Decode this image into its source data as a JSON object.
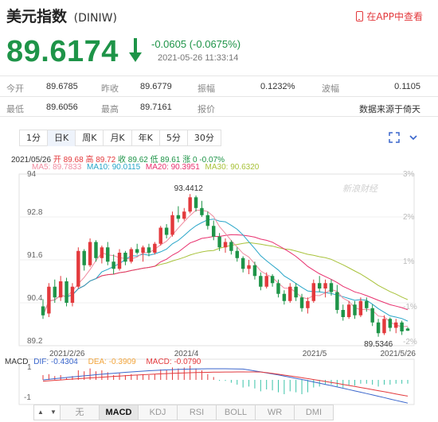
{
  "header": {
    "title": "美元指数",
    "code": "(DINIW)",
    "app_link": "在APP中查看"
  },
  "quote": {
    "price": "89.6174",
    "change": "-0.0605",
    "change_pct": "(-0.0675%)",
    "timestamp": "2021-05-26 11:33:14",
    "color": "#1e9448"
  },
  "info": {
    "row1": [
      {
        "label": "今开",
        "value": "89.6785"
      },
      {
        "label": "昨收",
        "value": "89.6779"
      },
      {
        "label": "振幅",
        "value": "0.1232%"
      },
      {
        "label": "波幅",
        "value": "0.1105"
      }
    ],
    "row2": [
      {
        "label": "最低",
        "value": "89.6056"
      },
      {
        "label": "最高",
        "value": "89.7161"
      },
      {
        "label": "报价",
        "value": "数据来源于倚天"
      }
    ]
  },
  "period_tabs": [
    "1分",
    "日K",
    "周K",
    "月K",
    "年K",
    "5分",
    "30分"
  ],
  "active_period": "日K",
  "tools": [
    "expand-icon",
    "chevron-down-icon"
  ],
  "ohlc_legend": {
    "date": "2021/05/26",
    "open": "开 89.68",
    "high": "高 89.72",
    "close": "收 89.62",
    "low": "低 89.61",
    "change": "涨 0 -0.07%"
  },
  "ma_legend": {
    "ma5": "MA5: 89.7833",
    "ma10": "MA10: 90.0115",
    "ma20": "MA20: 90.3951",
    "ma30": "MA30: 90.6320"
  },
  "colors": {
    "up": "#e3393c",
    "down": "#1e9448",
    "ma5": "#f08ca0",
    "ma10": "#27a5c8",
    "ma20": "#e8306e",
    "ma30": "#a8c23a",
    "diff": "#3a66cc",
    "dea": "#f2a43a",
    "macd": "#e3393c"
  },
  "watermark": "新浪财经",
  "macd_legend": {
    "name": "MACD",
    "diff": "DIF: -0.4304",
    "dea": "DEA: -0.3909",
    "macd": "MACD: -0.0790"
  },
  "bottom_tabs": [
    "无",
    "MACD",
    "KDJ",
    "RSI",
    "BOLL",
    "WR",
    "DMI"
  ],
  "active_bottom_tab": "MACD",
  "chart_data": {
    "type": "candlestick",
    "y_labels": [
      "94",
      "92.8",
      "91.6",
      "90.4",
      "89.2"
    ],
    "y_range": [
      89.2,
      94.0
    ],
    "right_labels": [
      "3%",
      "2%",
      "1%",
      "-1%",
      "-2%"
    ],
    "x_labels": [
      "2021/2/26",
      "2021/4",
      "2021/5",
      "2021/5/26"
    ],
    "max_label": "93.4412",
    "min_label": "89.5346",
    "macd_y_labels": [
      "1",
      "-1"
    ],
    "candles": [
      [
        90.3,
        90.5,
        89.95,
        90.05
      ],
      [
        90.1,
        90.95,
        90.0,
        90.85
      ],
      [
        90.85,
        91.05,
        90.4,
        90.55
      ],
      [
        90.55,
        91.15,
        90.45,
        91.0
      ],
      [
        91.0,
        91.1,
        90.3,
        90.4
      ],
      [
        90.4,
        90.95,
        90.3,
        90.85
      ],
      [
        90.85,
        91.95,
        90.8,
        91.85
      ],
      [
        91.85,
        91.9,
        91.3,
        91.45
      ],
      [
        91.45,
        92.2,
        91.4,
        92.1
      ],
      [
        92.1,
        92.15,
        91.55,
        91.65
      ],
      [
        91.65,
        92.0,
        91.5,
        91.95
      ],
      [
        91.95,
        92.1,
        91.45,
        91.55
      ],
      [
        91.55,
        91.75,
        91.2,
        91.35
      ],
      [
        91.35,
        91.9,
        91.3,
        91.8
      ],
      [
        91.8,
        91.85,
        91.45,
        91.55
      ],
      [
        91.55,
        91.95,
        91.5,
        91.9
      ],
      [
        91.9,
        92.05,
        91.75,
        91.8
      ],
      [
        91.8,
        92.0,
        91.55,
        91.95
      ],
      [
        91.95,
        92.05,
        91.7,
        91.8
      ],
      [
        91.8,
        92.1,
        91.75,
        92.05
      ],
      [
        92.05,
        92.55,
        92.0,
        92.5
      ],
      [
        92.5,
        92.6,
        92.2,
        92.3
      ],
      [
        92.3,
        92.95,
        92.25,
        92.85
      ],
      [
        92.85,
        93.1,
        92.65,
        92.75
      ],
      [
        92.75,
        93.05,
        92.7,
        92.95
      ],
      [
        92.95,
        93.44,
        92.9,
        93.35
      ],
      [
        93.35,
        93.4,
        92.95,
        93.05
      ],
      [
        93.05,
        93.25,
        92.8,
        92.85
      ],
      [
        92.85,
        92.95,
        92.45,
        92.55
      ],
      [
        92.55,
        92.7,
        92.15,
        92.25
      ],
      [
        92.25,
        92.35,
        91.85,
        91.95
      ],
      [
        91.95,
        92.2,
        91.8,
        92.1
      ],
      [
        92.1,
        92.15,
        91.75,
        91.85
      ],
      [
        91.85,
        91.95,
        91.55,
        91.65
      ],
      [
        91.65,
        91.7,
        91.25,
        91.35
      ],
      [
        91.35,
        91.6,
        91.2,
        91.45
      ],
      [
        91.45,
        91.55,
        91.05,
        91.15
      ],
      [
        91.15,
        91.25,
        90.75,
        90.85
      ],
      [
        90.85,
        91.25,
        90.8,
        91.15
      ],
      [
        91.15,
        91.2,
        90.85,
        90.95
      ],
      [
        90.95,
        91.05,
        90.55,
        90.65
      ],
      [
        90.65,
        90.75,
        90.35,
        90.45
      ],
      [
        90.45,
        90.95,
        90.4,
        90.85
      ],
      [
        90.85,
        90.95,
        90.45,
        90.55
      ],
      [
        90.55,
        90.65,
        90.15,
        90.25
      ],
      [
        90.25,
        90.55,
        90.1,
        90.45
      ],
      [
        90.45,
        91.05,
        90.4,
        90.95
      ],
      [
        90.95,
        91.15,
        90.7,
        90.8
      ],
      [
        90.8,
        91.05,
        90.55,
        90.95
      ],
      [
        90.95,
        91.05,
        90.6,
        90.7
      ],
      [
        90.7,
        90.9,
        90.1,
        90.2
      ],
      [
        90.2,
        90.35,
        89.9,
        90.0
      ],
      [
        90.0,
        90.45,
        89.95,
        90.35
      ],
      [
        90.35,
        90.45,
        89.95,
        90.05
      ],
      [
        90.05,
        90.55,
        90.0,
        90.45
      ],
      [
        90.45,
        90.55,
        90.15,
        90.25
      ],
      [
        90.25,
        90.35,
        89.75,
        89.85
      ],
      [
        89.85,
        89.95,
        89.45,
        89.55
      ],
      [
        89.55,
        90.05,
        89.5,
        89.95
      ],
      [
        89.95,
        89.99,
        89.6,
        89.7
      ],
      [
        89.7,
        89.95,
        89.55,
        89.85
      ],
      [
        89.85,
        89.9,
        89.5,
        89.6
      ],
      [
        89.68,
        89.72,
        89.61,
        89.62
      ]
    ],
    "macd_hist": [
      0.1,
      0.12,
      0.08,
      0.1,
      0.04,
      0.08,
      0.2,
      0.18,
      0.24,
      0.18,
      0.2,
      0.16,
      0.1,
      0.14,
      0.1,
      0.12,
      0.1,
      0.12,
      0.1,
      0.12,
      0.22,
      0.2,
      0.26,
      0.24,
      0.26,
      0.3,
      0.24,
      0.2,
      0.12,
      0.06,
      -0.02,
      -0.02,
      -0.06,
      -0.1,
      -0.16,
      -0.14,
      -0.18,
      -0.24,
      -0.2,
      -0.22,
      -0.26,
      -0.3,
      -0.24,
      -0.26,
      -0.3,
      -0.26,
      -0.16,
      -0.14,
      -0.1,
      -0.1,
      -0.14,
      -0.16,
      -0.12,
      -0.12,
      -0.08,
      -0.08,
      -0.1,
      -0.14,
      -0.1,
      -0.1,
      -0.08,
      -0.08,
      -0.08
    ]
  }
}
